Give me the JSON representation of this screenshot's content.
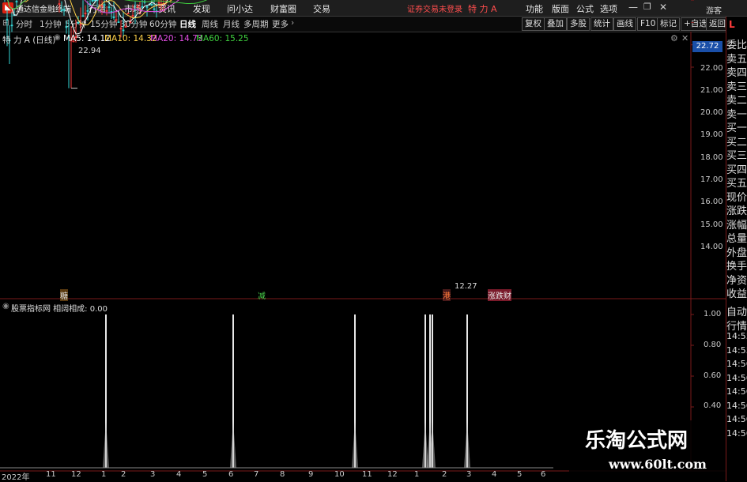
{
  "app": {
    "title": "通达信金融终端",
    "menus": [
      "行情",
      "市场",
      "资讯",
      "发现",
      "问小达",
      "财富圈",
      "交易"
    ],
    "notice": "证券交易未登录",
    "stock_name": "特 力 A",
    "right_menus": [
      "功能",
      "版面",
      "公式",
      "选项"
    ],
    "guest": "游客"
  },
  "toolbar": {
    "periods": [
      "分时",
      "1分钟",
      "5分钟",
      "15分钟",
      "30分钟",
      "60分钟",
      "日线",
      "周线",
      "月线",
      "多周期",
      "更多"
    ],
    "active_period": "日线",
    "buttons": [
      "复权",
      "叠加",
      "多股",
      "统计",
      "画线",
      "F10",
      "标记",
      "+自选",
      "返回"
    ]
  },
  "main": {
    "title": "特 力 A (日线)",
    "ma": [
      {
        "label": "MA5: 14.12",
        "color": "#ffffff"
      },
      {
        "label": "MA10: 14.32",
        "color": "#ffd24a"
      },
      {
        "label": "MA20: 14.73",
        "color": "#e44fe6"
      },
      {
        "label": "MA60: 15.25",
        "color": "#3fd13f"
      }
    ],
    "price_high": "22.94",
    "price_low": "12.27",
    "current_price": "22.72",
    "y_ticks": [
      "22.00",
      "21.00",
      "20.00",
      "19.00",
      "18.00",
      "17.00",
      "16.00",
      "15.00",
      "14.00"
    ],
    "events": [
      {
        "text": "糖",
        "color": "#ffb347"
      },
      {
        "text": "减",
        "color": "#49d14b"
      },
      {
        "text": "港",
        "color": "#ff7b3a"
      },
      {
        "text": "涨跌财",
        "color": "#e8e8e8"
      }
    ]
  },
  "sub": {
    "title": "股票指标网 相阔相成: 0.00",
    "y_ticks": [
      "1.00",
      "0.80",
      "0.60",
      "0.40"
    ],
    "x_ticks": [
      "2022年",
      "11",
      "12",
      "1",
      "2",
      "3",
      "4",
      "5",
      "6",
      "7",
      "8",
      "9",
      "10",
      "11",
      "12",
      "1",
      "2",
      "3",
      "4",
      "5",
      "6"
    ]
  },
  "right_panel": {
    "top_tag": "L",
    "rows": [
      "委比",
      "卖五",
      "卖四",
      "卖三",
      "卖二",
      "卖一",
      "买一",
      "买二",
      "买三",
      "买四",
      "买五",
      "现价",
      "涨跌",
      "涨幅",
      "总量",
      "外盘",
      "换手",
      "净资",
      "收益"
    ],
    "lower": [
      "自动",
      "行情",
      "14:55",
      "14:55",
      "14:56",
      "14:56",
      "14:56",
      "14:56",
      "14:56",
      "14:56"
    ]
  },
  "watermark": {
    "line1": "乐淘公式网",
    "line2": "www.60lt.com"
  },
  "colors": {
    "ma5": "#ffffff",
    "ma10": "#ffd24a",
    "ma20": "#e44fe6",
    "ma60": "#3fd13f",
    "candle_up": "#ff3b3b",
    "candle_down": "#35d6d6",
    "axis": "#7a1a1a"
  },
  "chart_data": {
    "type": "bar",
    "title": "相阔相成",
    "ylim": [
      0,
      1
    ],
    "note_series": "signal spikes (1.00) on the sub-chart",
    "x": [
      "2022-12",
      "2023-03",
      "2023-07",
      "2023-11",
      "2023-11",
      "2023-12",
      "2024-01"
    ],
    "values": [
      1,
      1,
      1,
      1,
      1,
      1,
      1
    ]
  }
}
